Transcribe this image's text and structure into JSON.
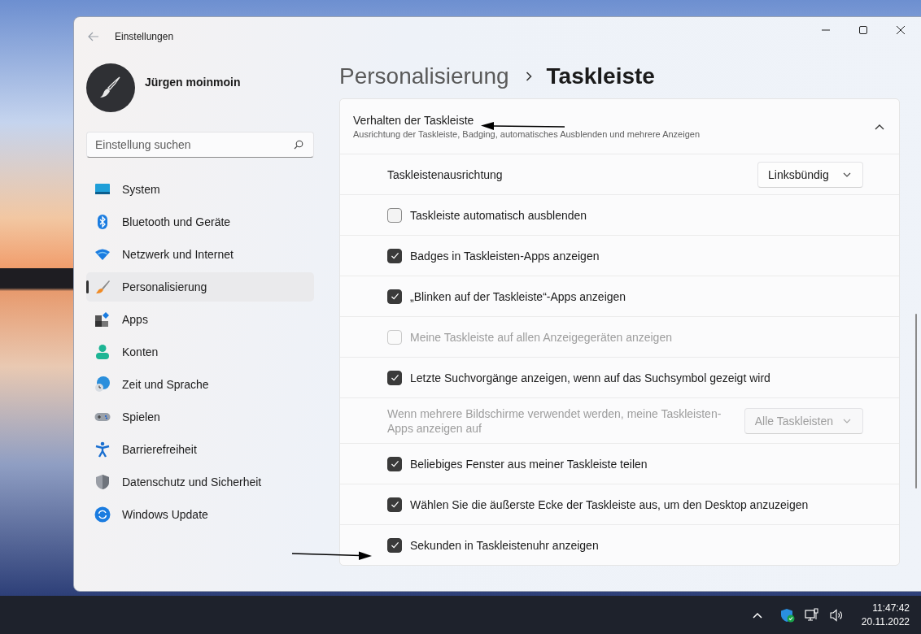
{
  "window": {
    "title": "Einstellungen"
  },
  "profile": {
    "name": "Jürgen moinmoin"
  },
  "search": {
    "placeholder": "Einstellung suchen"
  },
  "nav": [
    {
      "label": "System",
      "selected": false
    },
    {
      "label": "Bluetooth und Geräte",
      "selected": false
    },
    {
      "label": "Netzwerk und Internet",
      "selected": false
    },
    {
      "label": "Personalisierung",
      "selected": true
    },
    {
      "label": "Apps",
      "selected": false
    },
    {
      "label": "Konten",
      "selected": false
    },
    {
      "label": "Zeit und Sprache",
      "selected": false
    },
    {
      "label": "Spielen",
      "selected": false
    },
    {
      "label": "Barrierefreiheit",
      "selected": false
    },
    {
      "label": "Datenschutz und Sicherheit",
      "selected": false
    },
    {
      "label": "Windows Update",
      "selected": false
    }
  ],
  "breadcrumb": {
    "parent": "Personalisierung",
    "current": "Taskleiste"
  },
  "section": {
    "title": "Verhalten der Taskleiste",
    "subtitle": "Ausrichtung der Taskleiste, Badging, automatisches Ausblenden und mehrere Anzeigen",
    "expanded": true,
    "rows": [
      {
        "kind": "dropdown",
        "label": "Taskleistenausrichtung",
        "value": "Linksbündig",
        "disabled": false
      },
      {
        "kind": "checkbox",
        "label": "Taskleiste automatisch ausblenden",
        "checked": false,
        "disabled": false
      },
      {
        "kind": "checkbox",
        "label": "Badges in Taskleisten-Apps anzeigen",
        "checked": true,
        "disabled": false
      },
      {
        "kind": "checkbox",
        "label": "„Blinken auf der Taskleiste“-Apps anzeigen",
        "checked": true,
        "disabled": false
      },
      {
        "kind": "checkbox",
        "label": "Meine Taskleiste auf allen Anzeigegeräten anzeigen",
        "checked": false,
        "disabled": true
      },
      {
        "kind": "checkbox",
        "label": "Letzte Suchvorgänge anzeigen, wenn auf das Suchsymbol gezeigt wird",
        "checked": true,
        "disabled": false
      },
      {
        "kind": "dropdown",
        "label": "Wenn mehrere Bildschirme verwendet werden, meine Taskleisten-Apps anzeigen auf",
        "value": "Alle Taskleisten",
        "disabled": true
      },
      {
        "kind": "checkbox",
        "label": "Beliebiges Fenster aus meiner Taskleiste teilen",
        "checked": true,
        "disabled": false
      },
      {
        "kind": "checkbox",
        "label": "Wählen Sie die äußerste Ecke der Taskleiste aus, um den Desktop anzuzeigen",
        "checked": true,
        "disabled": false
      },
      {
        "kind": "checkbox",
        "label": "Sekunden in Taskleistenuhr anzeigen",
        "checked": true,
        "disabled": false
      }
    ]
  },
  "taskbar": {
    "time": "11:47:42",
    "date": "20.11.2022"
  }
}
